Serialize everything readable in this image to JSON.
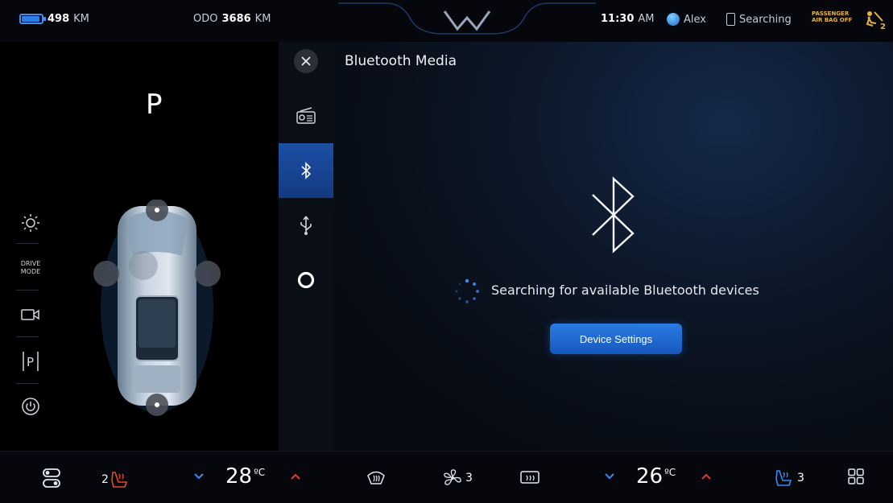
{
  "status": {
    "range_value": "498",
    "range_unit": "KM",
    "odo_label": "ODO",
    "odo_value": "3686",
    "odo_unit": "KM",
    "time": "11:30",
    "time_period": "AM",
    "user_name": "Alex",
    "phone_status": "Searching",
    "airbag_line1": "PASSENGER",
    "airbag_line2": "AIR BAG OFF",
    "airbag_badge": "2"
  },
  "vehicle": {
    "gear": "P",
    "drive_mode_line1": "DRIVE",
    "drive_mode_line2": "MODE",
    "parking_label": "P",
    "icons": [
      "light-icon",
      "drive-mode-label",
      "camera-icon",
      "parking-icon",
      "power-icon"
    ]
  },
  "media": {
    "title": "Bluetooth Media",
    "sources": [
      "close-icon",
      "radio-icon",
      "bluetooth-icon",
      "usb-icon",
      "voice-assistant-icon"
    ],
    "active_source": "bluetooth",
    "search_message": "Searching for available Bluetooth devices",
    "device_settings_label": "Device Settings"
  },
  "climate": {
    "driver_seat_heat_level": "2",
    "driver_temp": "28",
    "passenger_temp": "26",
    "temp_unit": "ºC",
    "fan_level": "3",
    "passenger_seat_level": "3"
  },
  "colors": {
    "accent": "#2f79e3",
    "seat_heat": "#e24a2b",
    "temp_up": "#e23a3a",
    "temp_down": "#3a8bf0",
    "warning": "#e8b23a"
  }
}
